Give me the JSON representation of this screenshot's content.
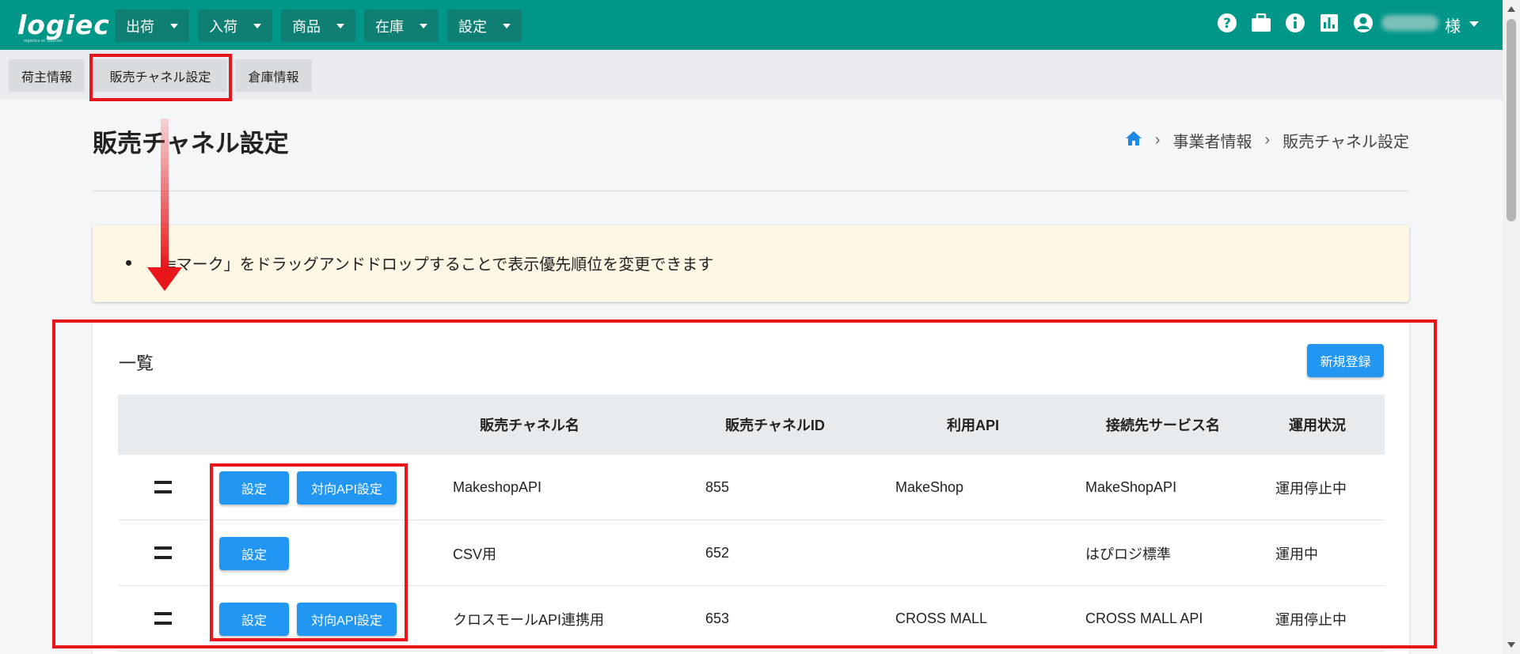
{
  "header": {
    "logo": "logiec",
    "logo_sub": "logistics ec solution",
    "nav": [
      {
        "label": "出荷"
      },
      {
        "label": "入荷"
      },
      {
        "label": "商品"
      },
      {
        "label": "在庫"
      },
      {
        "label": "設定"
      }
    ],
    "icons": [
      "help-icon",
      "briefcase-icon",
      "info-icon",
      "chart-icon",
      "account-icon"
    ],
    "user_suffix": "様"
  },
  "subtabs": [
    {
      "label": "荷主情報"
    },
    {
      "label": "販売チャネル設定"
    },
    {
      "label": "倉庫情報"
    }
  ],
  "page": {
    "title": "販売チャネル設定",
    "breadcrumb": [
      "事業者情報",
      "販売チャネル設定"
    ]
  },
  "notice": {
    "text": "「≡マーク」をドラッグアンドドロップすることで表示優先順位を変更できます"
  },
  "list": {
    "title": "一覧",
    "new_button": "新規登録",
    "columns": [
      "販売チャネル名",
      "販売チャネルID",
      "利用API",
      "接続先サービス名",
      "運用状況"
    ],
    "settings_label": "設定",
    "api_settings_label": "対向API設定",
    "rows": [
      {
        "name": "MakeshopAPI",
        "id": "855",
        "api": "MakeShop",
        "service": "MakeShopAPI",
        "status": "運用停止中",
        "has_api": true
      },
      {
        "name": "CSV用",
        "id": "652",
        "api": "",
        "service": "はぴロジ標準",
        "status": "運用中",
        "has_api": false
      },
      {
        "name": "クロスモールAPI連携用",
        "id": "653",
        "api": "CROSS MALL",
        "service": "CROSS MALL API",
        "status": "運用停止中",
        "has_api": true
      }
    ]
  },
  "colors": {
    "header": "#009688",
    "primary_button": "#2196f3",
    "annotation": "#e8161b",
    "notice_bg": "#fdf7e3"
  }
}
